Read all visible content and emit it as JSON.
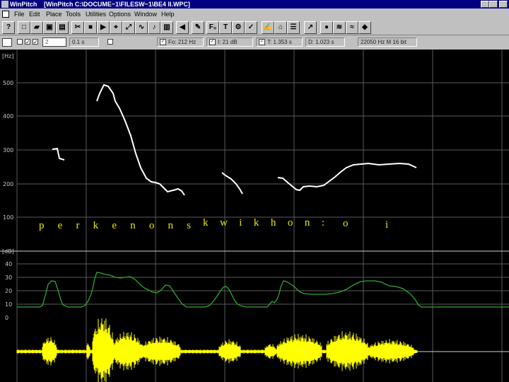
{
  "titlebar": {
    "app_name": "WinPitch",
    "doc_title": "[WinPitch C:\\DOCUME~1\\FILESW~1\\BE4 II.WPC]"
  },
  "menu": [
    {
      "label": "File"
    },
    {
      "label": "Edit"
    },
    {
      "label": "Place"
    },
    {
      "label": "Tools"
    },
    {
      "label": "Utilities"
    },
    {
      "label": "Options"
    },
    {
      "label": "Window"
    },
    {
      "label": "Help"
    }
  ],
  "toolbar": {
    "buttons": [
      {
        "icon": "help-icon",
        "glyph": "?"
      },
      {
        "icon": "new-file-icon",
        "glyph": "□"
      },
      {
        "icon": "open-folder-icon",
        "glyph": "▰"
      },
      {
        "icon": "save-icon",
        "glyph": "▣"
      },
      {
        "icon": "print-icon",
        "glyph": "▤"
      },
      {
        "icon": "cut-icon",
        "glyph": "✂"
      },
      {
        "icon": "stop-icon",
        "glyph": "■"
      },
      {
        "icon": "play-icon",
        "glyph": "▶"
      },
      {
        "icon": "select-icon",
        "glyph": "⌖"
      },
      {
        "icon": "zoom-icon",
        "glyph": "⤢"
      },
      {
        "icon": "curve-icon",
        "glyph": "∿"
      },
      {
        "icon": "pitch-icon",
        "glyph": "♪"
      },
      {
        "icon": "spectrum-icon",
        "glyph": "▥"
      },
      {
        "icon": "speaker-icon",
        "glyph": "◀"
      },
      {
        "icon": "edit-icon",
        "glyph": "✎"
      },
      {
        "icon": "formant-icon",
        "glyph": "F₀"
      },
      {
        "icon": "text-icon",
        "glyph": "T"
      },
      {
        "icon": "settings-icon",
        "glyph": "⚙"
      },
      {
        "icon": "mark-icon",
        "glyph": "✓"
      },
      {
        "icon": "annotate-icon",
        "glyph": "✍"
      },
      {
        "icon": "segment-icon",
        "glyph": "⌂"
      },
      {
        "icon": "list-icon",
        "glyph": "☰"
      },
      {
        "icon": "pick-icon",
        "glyph": "↗"
      },
      {
        "icon": "record-icon",
        "glyph": "●"
      },
      {
        "icon": "analysis-icon",
        "glyph": "≋"
      },
      {
        "icon": "wave-icon",
        "glyph": "≈"
      },
      {
        "icon": "palette-icon",
        "glyph": "◆"
      }
    ]
  },
  "statusbar": {
    "spin_value": "2",
    "field_dt": "0.1 s",
    "field_f0": "Fo: 212 Hz",
    "field_level": "I: 21 dB",
    "field_time": "T: 1.353 s",
    "field_duration": "D: 1.023 s",
    "field_samplerate": "22050 Hz  M  16 bit"
  },
  "plot": {
    "hz_unit": "[Hz]",
    "hz_ticks": [
      "500",
      "400",
      "300",
      "200",
      "100"
    ],
    "db_unit": "[dB]",
    "db_ticks": [
      "40",
      "30",
      "20",
      "10",
      "0"
    ],
    "phonetic_segments": [
      "p e r k e n o n s",
      "k w i k h o n :",
      "o",
      "i"
    ],
    "colors": {
      "pitch_curve": "#ffffff",
      "intensity_curve": "#2ea82e",
      "phonetic_text": "#e8e800",
      "waveform": "#ffff00",
      "grid": "#5a5a5a"
    }
  }
}
